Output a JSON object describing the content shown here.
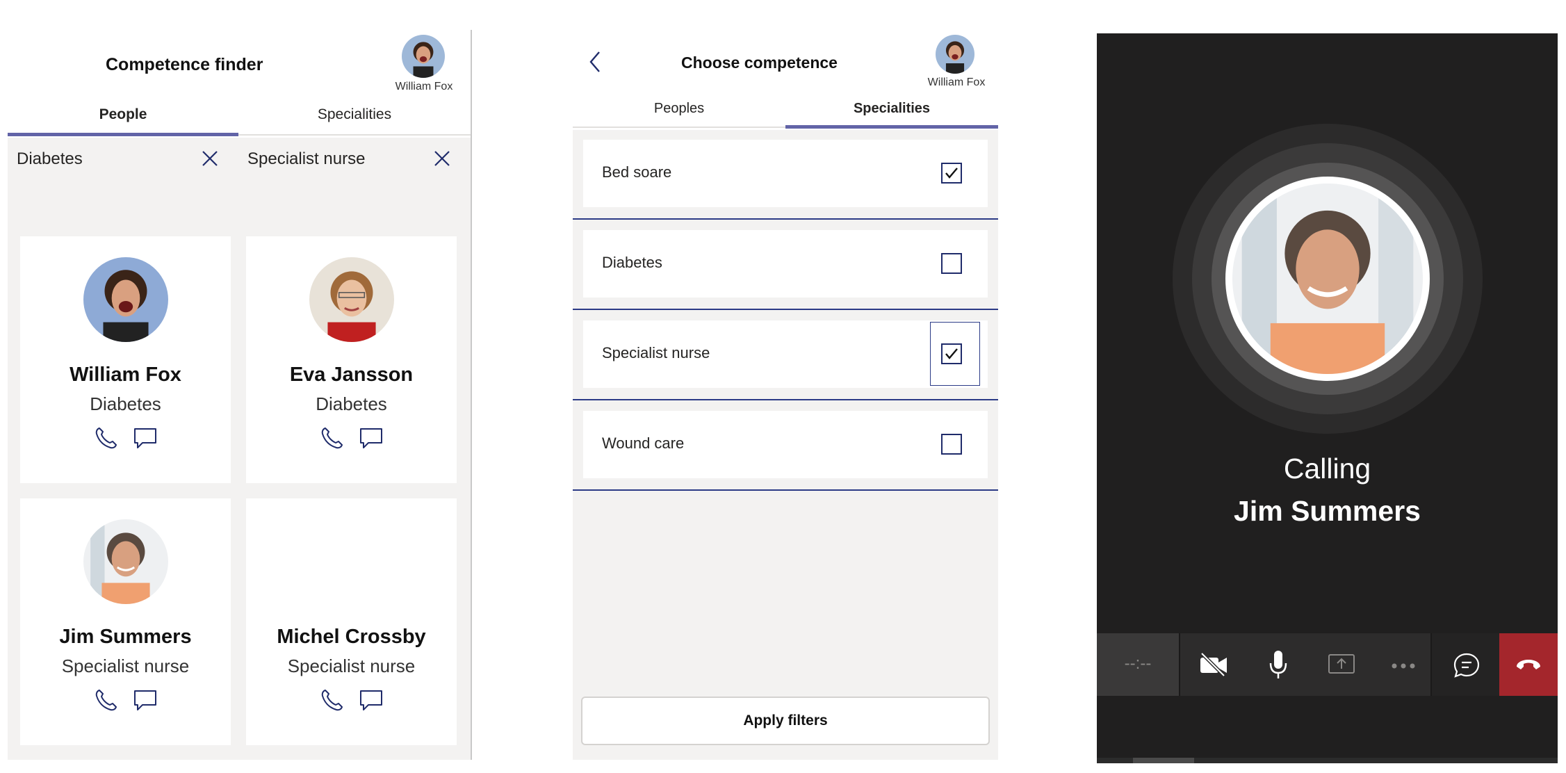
{
  "screen1": {
    "title": "Competence finder",
    "user_name": "William Fox",
    "tabs": [
      "People",
      "Specialities"
    ],
    "active_tab": "People",
    "filters": [
      "Diabetes",
      "Specialist nurse"
    ],
    "people": [
      {
        "name": "William Fox",
        "speciality": "Diabetes",
        "avatar": "person-avatar"
      },
      {
        "name": "Eva Jansson",
        "speciality": "Diabetes",
        "avatar": "person-avatar"
      },
      {
        "name": "Jim Summers",
        "speciality": "Specialist nurse",
        "avatar": "person-avatar"
      },
      {
        "name": "Michel Crossby",
        "speciality": "Specialist nurse",
        "avatar": "none"
      }
    ],
    "accent_color": "#6264a7"
  },
  "screen2": {
    "title": "Choose competence",
    "user_name": "William Fox",
    "tabs": [
      "Peoples",
      "Specialities"
    ],
    "active_tab": "Specialities",
    "items": [
      {
        "label": "Bed soare",
        "checked": true
      },
      {
        "label": "Diabetes",
        "checked": false
      },
      {
        "label": "Specialist nurse",
        "checked": true
      },
      {
        "label": "Wound care",
        "checked": false
      }
    ],
    "apply_label": "Apply filters"
  },
  "screen3": {
    "calling_label": "Calling",
    "callee_name": "Jim Summers",
    "timer": "--:--",
    "controls": [
      "video-off-icon",
      "microphone-icon",
      "share-screen-icon",
      "more-icon",
      "chat-icon",
      "hang-up-icon"
    ],
    "end_call_color": "#a4262c"
  }
}
